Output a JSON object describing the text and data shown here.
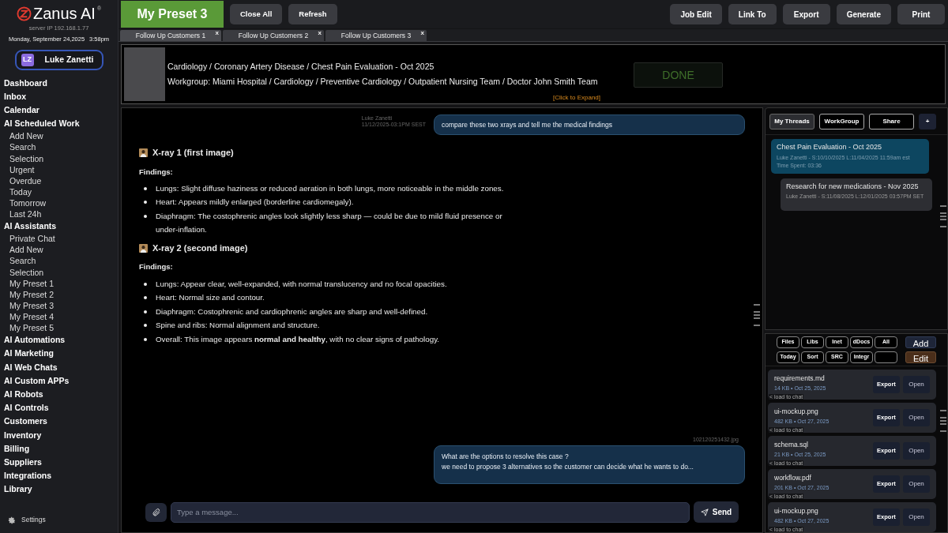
{
  "brand": {
    "name": "Zanus AI",
    "mark": "®",
    "server": "server IP 192.168.1.77",
    "date": "Monday, September 24,2025",
    "time": "3:58pm"
  },
  "user": {
    "initials": "LZ",
    "name": "Luke Zanetti"
  },
  "nav": [
    {
      "label": "Dashboard",
      "kind": "section"
    },
    {
      "label": "Inbox",
      "kind": "section"
    },
    {
      "label": "Calendar",
      "kind": "section"
    },
    {
      "label": "AI Scheduled Work",
      "kind": "section"
    },
    {
      "label": "Add New",
      "kind": "sub"
    },
    {
      "label": "Search",
      "kind": "sub"
    },
    {
      "label": "Selection",
      "kind": "sub"
    },
    {
      "label": "Urgent",
      "kind": "sub"
    },
    {
      "label": "Overdue",
      "kind": "sub"
    },
    {
      "label": "Today",
      "kind": "sub"
    },
    {
      "label": "Tomorrow",
      "kind": "sub"
    },
    {
      "label": "Last 24h",
      "kind": "sub"
    },
    {
      "label": "AI Assistants",
      "kind": "section"
    },
    {
      "label": "Private Chat",
      "kind": "sub"
    },
    {
      "label": "Add New",
      "kind": "sub"
    },
    {
      "label": "Search",
      "kind": "sub"
    },
    {
      "label": "Selection",
      "kind": "sub"
    },
    {
      "label": "My Preset 1",
      "kind": "sub"
    },
    {
      "label": "My Preset 2",
      "kind": "sub"
    },
    {
      "label": "My Preset 3",
      "kind": "sub"
    },
    {
      "label": "My Preset 4",
      "kind": "sub"
    },
    {
      "label": "My Preset 5",
      "kind": "sub"
    },
    {
      "label": "AI Automations",
      "kind": "section"
    },
    {
      "label": "AI Marketing",
      "kind": "section"
    },
    {
      "label": "AI Web Chats",
      "kind": "section"
    },
    {
      "label": "AI Custom APPs",
      "kind": "section"
    },
    {
      "label": "AI Robots",
      "kind": "section"
    },
    {
      "label": "AI Controls",
      "kind": "section"
    },
    {
      "label": "Customers",
      "kind": "section"
    },
    {
      "label": "Inventory",
      "kind": "section"
    },
    {
      "label": "Billing",
      "kind": "section"
    },
    {
      "label": "Suppliers",
      "kind": "section"
    },
    {
      "label": "Integrations",
      "kind": "section"
    },
    {
      "label": "Library",
      "kind": "section"
    }
  ],
  "settings": "Settings",
  "title": "My Preset 3",
  "toolbar_left": [
    "Close All",
    "Refresh"
  ],
  "toolbar_right": [
    "Job Edit",
    "Link To",
    "Export",
    "Generate",
    "Print"
  ],
  "tabs": [
    {
      "label": "Follow Up Customers 1",
      "close": "x",
      "selected": true
    },
    {
      "label": "Follow Up Customers 2",
      "close": "x",
      "selected": false
    },
    {
      "label": "Follow Up Customers 3",
      "close": "x",
      "selected": false
    }
  ],
  "case": {
    "path": "Cardiology /  Coronary Artery Disease / Chest Pain Evaluation - Oct 2025",
    "workgroup": "Workgroup: Miami Hospital / Cardiology / Preventive Cardiology / Outpatient Nursing Team / Doctor John Smith Team",
    "status": "DONE",
    "expand": "[Click to Expand]"
  },
  "chat": {
    "messages": [
      {
        "kind": "user",
        "author": "Luke Zanetti",
        "time": "11/12/2025-03:1PM SEST",
        "lines": [
          "compare these two xrays and tell me the medical findings"
        ]
      },
      {
        "kind": "assistant",
        "sections": [
          {
            "title": "X-ray 1 (first image)",
            "label": "Findings:",
            "bullets": [
              "Lungs: Slight diffuse haziness or reduced aeration in both lungs, more noticeable in the middle zones.",
              "Heart: Appears mildly enlarged (borderline cardiomegaly).",
              "Diaphragm: The costophrenic angles look slightly less sharp — could be due to mild fluid presence or under-inflation."
            ]
          },
          {
            "title": "X-ray 2 (second image)",
            "label": "Findings:",
            "bullets": [
              "Lungs: Appear clear, well-expanded, with normal translucency and no focal opacities.",
              "Heart: Normal size and contour.",
              "Diaphragm: Costophrenic and cardiophrenic angles are sharp and well-defined.",
              "Spine and ribs: Normal alignment and structure.",
              "Overall: This image appears **normal and healthy**, with no clear signs of pathology."
            ]
          }
        ]
      },
      {
        "kind": "user",
        "file": "102120251432.jpg",
        "lines": [
          "What are the options to resolve this case ?",
          "we need to propose 3 alternatives so the customer can decide what he wants to do..."
        ]
      }
    ],
    "placeholder": "Type a message...",
    "send": "Send"
  },
  "thread_buttons": [
    {
      "label": "My Threads",
      "selected": true
    },
    {
      "label": "WorkGroup",
      "selected": false
    },
    {
      "label": "Share",
      "selected": false
    },
    {
      "label": "+",
      "selected": false
    }
  ],
  "threads": [
    {
      "title": "Chest Pain Evaluation - Oct 2025",
      "meta": "Luke Zanetti - S:10/10/2025  L:11/04/2025 11:59am est",
      "extra": "Time Spent: 03:36",
      "selected": true
    },
    {
      "title": "Research for new medications - Nov 2025",
      "meta": "Luke Zanetti - S:11/08/2025 L:12/01/2025 03:57PM SET",
      "selected": false
    }
  ],
  "file_filters": [
    [
      "Files",
      "Libs",
      "Inet",
      "dDocs",
      "All"
    ],
    [
      "Today",
      "Sort",
      "SRC",
      "Integr"
    ]
  ],
  "file_actions": [
    "Add",
    "Edit"
  ],
  "files": [
    {
      "name": "requirements.md",
      "meta": "14 KB • Oct 25, 2025",
      "load": "< load to chat",
      "export": "Export",
      "open": "Open"
    },
    {
      "name": "ui-mockup.png",
      "meta": "482 KB • Oct 27, 2025",
      "load": "< load to chat",
      "export": "Export",
      "open": "Open"
    },
    {
      "name": "schema.sql",
      "meta": "21 KB • Oct 25, 2025",
      "load": "< load to chat",
      "export": "Export",
      "open": "Open"
    },
    {
      "name": "workflow.pdf",
      "meta": "201 KB • Oct 27, 2025",
      "load": "< load to chat",
      "export": "Export",
      "open": "Open"
    },
    {
      "name": "ui-mockup.png",
      "meta": "482 KB • Oct 27, 2025",
      "load": "< load to chat",
      "export": "Export",
      "open": "Open"
    }
  ]
}
